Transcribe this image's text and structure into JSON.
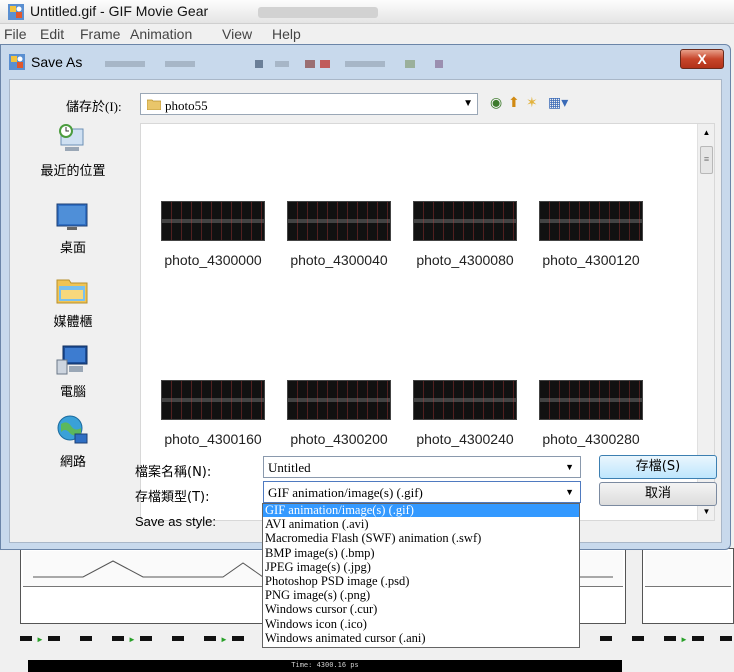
{
  "app": {
    "title": "Untitled.gif - GIF Movie Gear",
    "menu": [
      "File",
      "Edit",
      "Frame",
      "Animation",
      "View",
      "Help"
    ]
  },
  "dialog": {
    "title": "Save As",
    "close_label": "X",
    "location_label": "儲存於(I):",
    "location_value": "photo55",
    "places": [
      {
        "label": "最近的位置",
        "icon": "recent-places-icon"
      },
      {
        "label": "桌面",
        "icon": "desktop-icon"
      },
      {
        "label": "媒體櫃",
        "icon": "libraries-icon"
      },
      {
        "label": "電腦",
        "icon": "computer-icon"
      },
      {
        "label": "網路",
        "icon": "network-icon"
      }
    ],
    "files": [
      "photo_4300000",
      "photo_4300040",
      "photo_4300080",
      "photo_4300120",
      "photo_4300160",
      "photo_4300200",
      "photo_4300240",
      "photo_4300280"
    ],
    "filename_label": "檔案名稱(N):",
    "filename_value": "Untitled",
    "filetype_label": "存檔類型(T):",
    "filetype_value": "GIF animation/image(s) (.gif)",
    "save_style_label": "Save as style:",
    "save_button": "存檔(S)",
    "cancel_button": "取消",
    "filetype_options": [
      "GIF animation/image(s) (.gif)",
      "AVI animation (.avi)",
      "Macromedia Flash (SWF) animation (.swf)",
      "BMP image(s) (.bmp)",
      "JPEG image(s) (.jpg)",
      "Photoshop PSD image (.psd)",
      "PNG image(s) (.png)",
      "Windows cursor (.cur)",
      "Windows icon (.ico)",
      "Windows animated cursor (.ani)"
    ],
    "selected_option_index": 0
  },
  "frame_caption": "Time: 4300.16 ps",
  "colors": {
    "dialog_frame": "#c8d9ec",
    "selection": "#3399ff",
    "close_button": "#c7452a"
  }
}
